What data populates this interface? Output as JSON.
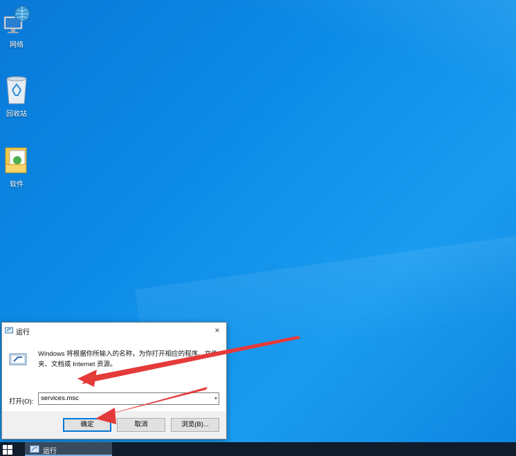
{
  "desktop": {
    "icons": [
      {
        "label": "网络",
        "icon": "network-icon"
      },
      {
        "label": "回收站",
        "icon": "recycle-bin-icon"
      },
      {
        "label": "软件",
        "icon": "folder-icon"
      }
    ]
  },
  "run_dialog": {
    "title": "运行",
    "close_label": "×",
    "description": "Windows 将根据你所输入的名称，为你打开相应的程序、文件夹、文档或 Internet 资源。",
    "open_label": "打开(O):",
    "open_value": "services.msc",
    "buttons": {
      "ok": "确定",
      "cancel": "取消",
      "browse": "浏览(B)..."
    }
  },
  "taskbar": {
    "task_label": "运行"
  },
  "colors": {
    "desktop_blue": "#0b8ae6",
    "annotation_red": "#e53a3a",
    "taskbar": "#101c2c"
  }
}
